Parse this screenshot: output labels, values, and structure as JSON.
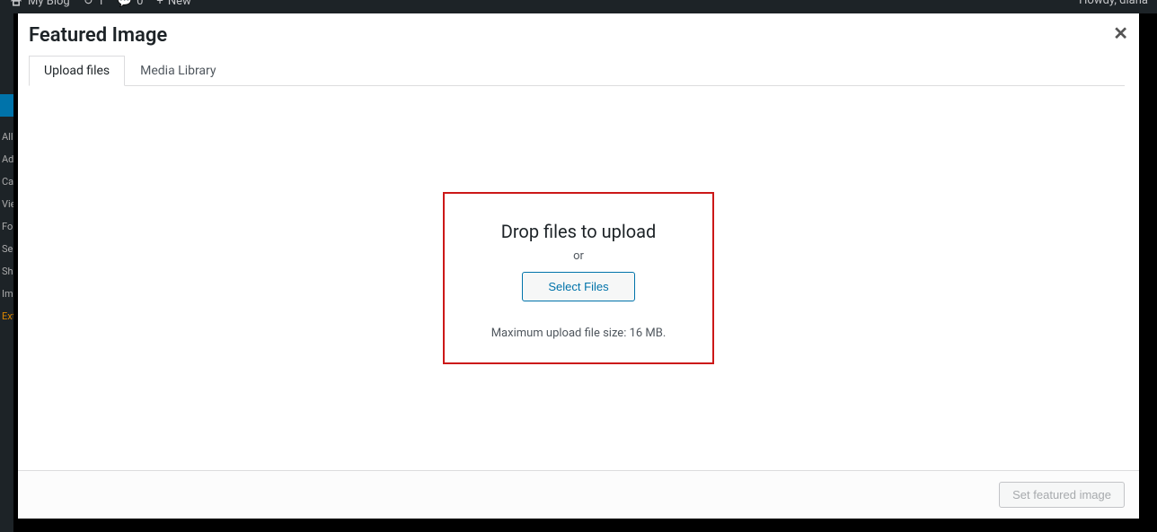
{
  "adminBar": {
    "siteTitle": "My Blog",
    "updateCount": "1",
    "commentCount": "0",
    "newLabel": "New",
    "greeting": "Howdy, diana"
  },
  "sidebar": {
    "items": [
      {
        "label": "All"
      },
      {
        "label": "Ad"
      },
      {
        "label": "Ca"
      },
      {
        "label": "Vie"
      },
      {
        "label": "Fo"
      },
      {
        "label": "Se"
      },
      {
        "label": "Sh"
      },
      {
        "label": "Im"
      },
      {
        "label": "Ext"
      }
    ]
  },
  "modal": {
    "title": "Featured Image",
    "tabs": {
      "upload": "Upload files",
      "library": "Media Library"
    },
    "upload": {
      "dropText": "Drop files to upload",
      "orText": "or",
      "selectButton": "Select Files",
      "maxSize": "Maximum upload file size: 16 MB."
    },
    "footer": {
      "setButton": "Set featured image"
    }
  }
}
